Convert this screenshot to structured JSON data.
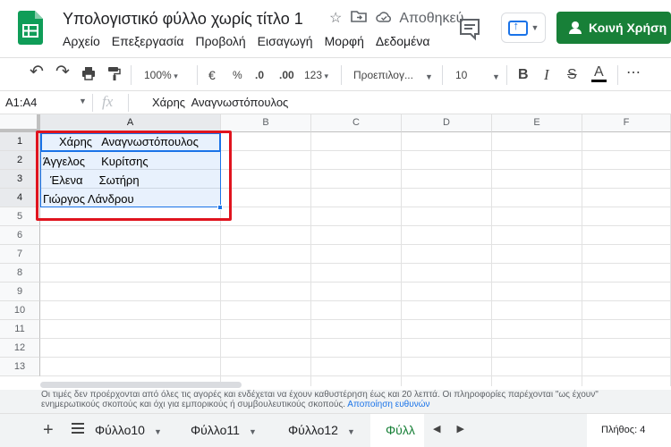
{
  "app": {
    "title": "Υπολογιστικό φύλλο χωρίς τίτλο 1",
    "save_status": "Αποθηκεύ",
    "share_label": "Κοινή Χρήση"
  },
  "menu": [
    "Αρχείο",
    "Επεξεργασία",
    "Προβολή",
    "Εισαγωγή",
    "Μορφή",
    "Δεδομένα"
  ],
  "toolbar": {
    "undo": "↶",
    "redo": "↷",
    "zoom": "100%",
    "currency": "€",
    "percent": "%",
    "decimal_decrease": ".0",
    "decimal_increase": ".00",
    "number_format": "123",
    "font": "Προεπιλογ...",
    "font_size": "10",
    "bold": "B",
    "italic": "I",
    "strike": "S",
    "text_color": "A",
    "more": "⋯"
  },
  "formula_bar": {
    "name_box": "A1:A4",
    "fx": "fx",
    "content": "Χάρης  Αναγνωστόπουλος"
  },
  "grid": {
    "columns": [
      "A",
      "B",
      "C",
      "D",
      "E",
      "F"
    ],
    "rows": [
      "1",
      "2",
      "3",
      "4",
      "5",
      "6",
      "7",
      "8",
      "9",
      "10",
      "11",
      "12",
      "13"
    ],
    "cells": {
      "a1": "Χάρης   Αναγνωστόπουλος",
      "a2": "Άγγελος     Κυρίτσης",
      "a3": "Έλενα     Σωτήρη",
      "a4": "Γιώργος Λάνδρου"
    }
  },
  "info": {
    "line1": "Οι τιμές δεν προέρχονται από όλες τις αγορές και ενδέχεται να έχουν καθυστέρηση έως και 20 λεπτά. Οι πληροφορίες παρέχονται \"ως έχουν\"",
    "line2": "ενημερωτικούς σκοπούς και όχι για εμπορικούς ή συμβουλευτικούς σκοπούς.",
    "disclaimer_link": "Αποποίηση ευθυνών"
  },
  "sheets": {
    "add": "+",
    "tabs": [
      "Φύλλο10",
      "Φύλλο11",
      "Φύλλο12",
      "Φύλλ"
    ],
    "count": "Πλήθος: 4"
  },
  "colors": {
    "accent": "#1a73e8",
    "share": "#188038",
    "highlight": "#e0141e"
  }
}
